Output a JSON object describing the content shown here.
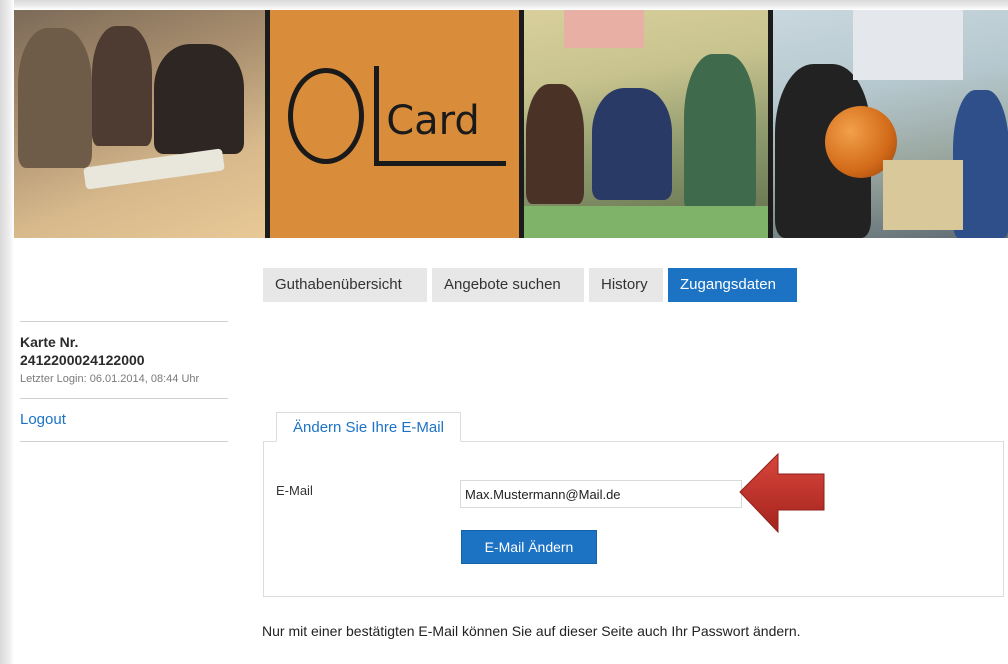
{
  "brand": {
    "logo_letters": "OL",
    "logo_word": "Card",
    "accent_color": "#d98d3b",
    "primary_color": "#1c73c4"
  },
  "nav": {
    "tabs": [
      {
        "label": "Guthabenübersicht",
        "active": false
      },
      {
        "label": "Angebote suchen",
        "active": false
      },
      {
        "label": "History",
        "active": false
      },
      {
        "label": "Zugangsdaten",
        "active": true
      }
    ]
  },
  "sidebar": {
    "card_label": "Karte Nr.",
    "card_number": "2412200024122000",
    "last_login": "Letzter Login: 06.01.2014, 08:44 Uhr",
    "logout_label": "Logout"
  },
  "email_panel": {
    "tab_label": "Ändern Sie Ihre E-Mail",
    "field_label": "E-Mail",
    "field_value": "Max.Mustermann@Mail.de",
    "submit_label": "E-Mail Ändern",
    "arrow_color": "#c0302a"
  },
  "footer_note": "Nur mit einer bestätigten E-Mail können Sie auf dieser Seite auch Ihr Passwort ändern."
}
